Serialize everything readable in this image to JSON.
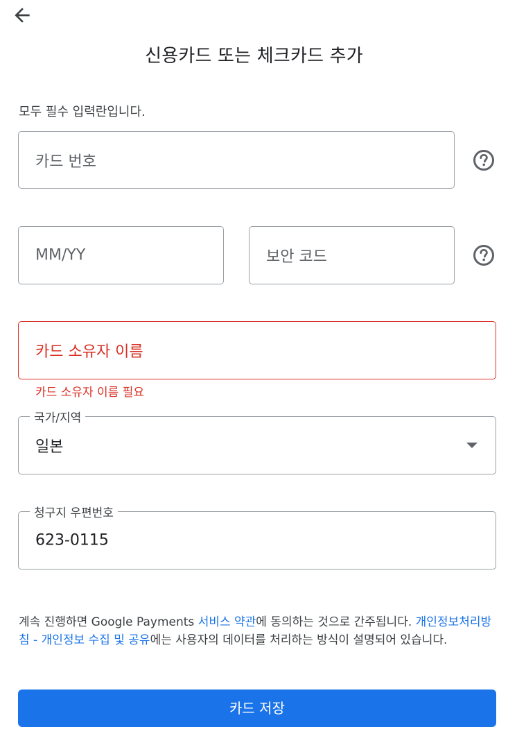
{
  "header": {
    "back_icon": "arrow-left-icon",
    "title": "신용카드 또는 체크카드 추가"
  },
  "form": {
    "required_note": "모두 필수 입력란입니다.",
    "card_number": {
      "placeholder": "카드 번호",
      "help_icon": "help-circle-icon"
    },
    "expiry": {
      "placeholder": "MM/YY"
    },
    "security_code": {
      "placeholder": "보안 코드",
      "help_icon": "help-circle-icon"
    },
    "cardholder_name": {
      "placeholder": "카드 소유자 이름",
      "error": "카드 소유자 이름 필요"
    },
    "country": {
      "label": "국가/지역",
      "value": "일본",
      "dropdown_icon": "caret-down-icon"
    },
    "postal_code": {
      "label": "청구지 우편번호",
      "value": "623-0115"
    }
  },
  "legal": {
    "text1": "계속 진행하면 Google Payments ",
    "link1": "서비스 약관",
    "text2": "에 동의하는 것으로 간주됩니다. ",
    "link2": "개인정보처리방침 - 개인정보 수집 및 공유",
    "text3": "에는 사용자의 데이터를 처리하는 방식이 설명되어 있습니다."
  },
  "actions": {
    "save_label": "카드 저장"
  },
  "colors": {
    "accent": "#1a73e8",
    "error": "#d93025",
    "border": "#9aa0a6"
  }
}
